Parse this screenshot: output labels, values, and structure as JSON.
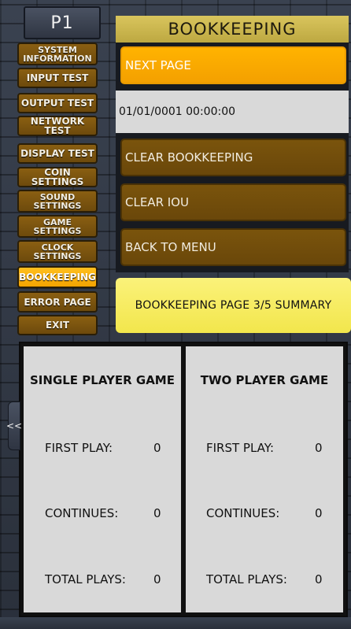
{
  "header": {
    "player": "P1",
    "title": "BOOKKEEPING"
  },
  "sidebar": {
    "items": [
      {
        "label": "SYSTEM\nINFORMATION"
      },
      {
        "label": "INPUT TEST"
      },
      {
        "label": "OUTPUT TEST"
      },
      {
        "label": "NETWORK TEST"
      },
      {
        "label": "DISPLAY TEST"
      },
      {
        "label": "COIN SETTINGS"
      },
      {
        "label": "SOUND\nSETTINGS"
      },
      {
        "label": "GAME\nSETTINGS"
      },
      {
        "label": "CLOCK\nSETTINGS"
      },
      {
        "label": "BOOKKEEPING"
      },
      {
        "label": "ERROR PAGE"
      },
      {
        "label": "EXIT"
      }
    ],
    "active_index": 9
  },
  "actions": {
    "next_page": "NEXT PAGE",
    "datetime": "01/01/0001 00:00:00",
    "clear_bookkeeping": "CLEAR BOOKKEEPING",
    "clear_iou": "CLEAR IOU",
    "back_to_menu": "BACK TO MENU"
  },
  "page_label": "BOOKKEEPING PAGE 3/5 SUMMARY",
  "summary": {
    "single": {
      "title": "SINGLE PLAYER GAME",
      "rows": [
        {
          "label": "FIRST PLAY:",
          "value": "0"
        },
        {
          "label": "CONTINUES:",
          "value": "0"
        },
        {
          "label": "TOTAL PLAYS:",
          "value": "0"
        }
      ]
    },
    "two": {
      "title": "TWO PLAYER GAME",
      "rows": [
        {
          "label": "FIRST PLAY:",
          "value": "0"
        },
        {
          "label": "CONTINUES:",
          "value": "0"
        },
        {
          "label": "TOTAL PLAYS:",
          "value": "0"
        }
      ]
    }
  },
  "side_tab": {
    "label": "<<"
  },
  "colors": {
    "accent_orange": "#f4a000",
    "accent_dark_gold": "#6a470a",
    "title_gold": "#c9b34e",
    "label_yellow": "#f2e64c",
    "panel_gray": "#d9d9d9"
  }
}
